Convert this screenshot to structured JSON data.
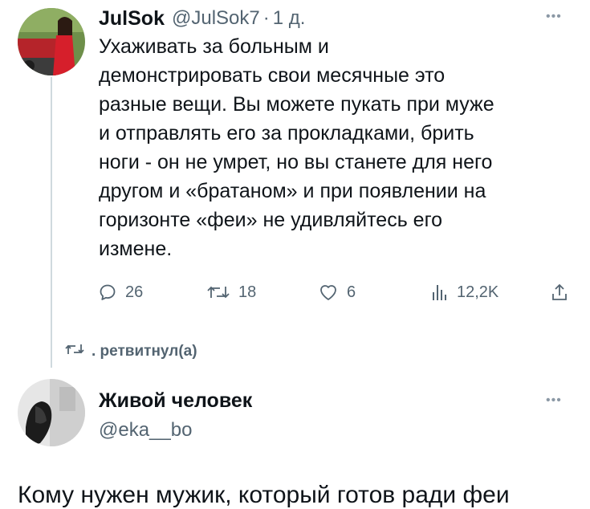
{
  "tweet": {
    "author_name": "JulSok",
    "handle": "@JulSok7",
    "separator": "·",
    "time": "1 д.",
    "more_icon": "more-dots-icon",
    "text": "Ухаживать за больным и\nдемонстрировать свои месячные это\nразные вещи.  Вы можете пукать при муже\nи отправлять его за прокладками, брить\nноги - он не умрет, но вы станете для него\nдругом и «братаном» и при появлении на\nгоризонте «феи» не удивляйтесь его\nизмене.",
    "actions": {
      "replies": "26",
      "retweets": "18",
      "likes": "6",
      "views": "12,2K"
    }
  },
  "retweet_banner": {
    "label": ". ретвитнул(а)"
  },
  "next_user": {
    "name": "Живой человек",
    "handle": "@eka__bo"
  },
  "next_text": "Кому нужен мужик, который готов ради феи",
  "colors": {
    "text": "#0f1419",
    "secondary": "#536471",
    "thread_line": "#cfd9de"
  }
}
